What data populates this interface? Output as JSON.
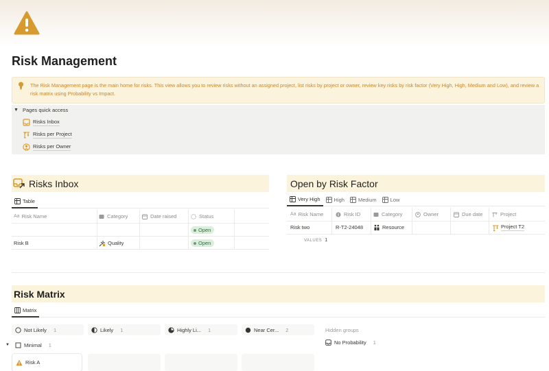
{
  "page": {
    "title": "Risk Management",
    "callout_text": "The Risk Management page is the main home for risks. This view allows you to review risks without an assigned project, list risks by project or owner, review key risks by risk factor (Very High, High, Medium and Low), and review a risk matrix using Probability vs Impact.",
    "icon": "warning-icon"
  },
  "quick_access": {
    "title": "Pages quick access",
    "items": [
      {
        "label": "Risks Inbox",
        "icon": "inbox-icon"
      },
      {
        "label": "Risks per Project",
        "icon": "crane-icon"
      },
      {
        "label": "Risks per Owner",
        "icon": "person-icon"
      }
    ]
  },
  "risks_inbox": {
    "title": "Risks Inbox",
    "tab": "Table",
    "columns": [
      "Risk Name",
      "Category",
      "Date raised",
      "Status"
    ],
    "rows": [
      {
        "name": "",
        "category": "",
        "date": "",
        "status": "Open"
      },
      {
        "name": "Risk B",
        "category": "Quality",
        "date": "",
        "status": "Open"
      }
    ]
  },
  "risk_factor": {
    "title": "Open by Risk Factor",
    "tabs": [
      "Very High",
      "High",
      "Medium",
      "Low"
    ],
    "columns": [
      "Risk Name",
      "Risk ID",
      "Category",
      "Owner",
      "Due date",
      "Project"
    ],
    "rows": [
      {
        "name": "Risk two",
        "risk_id": "R-T2-24048",
        "category": "Resource",
        "owner": "",
        "due": "",
        "project": "Project T2"
      }
    ],
    "values_label": "VALUES",
    "values_count": "1"
  },
  "risk_matrix": {
    "title": "Risk Matrix",
    "tab": "Matrix",
    "columns": [
      {
        "label": "Not Likely",
        "count": "1"
      },
      {
        "label": "Likely",
        "count": "1"
      },
      {
        "label": "Highly Li...",
        "count": "1"
      },
      {
        "label": "Near Cer...",
        "count": "2"
      }
    ],
    "hidden_groups_label": "Hidden groups",
    "hidden_group": {
      "label": "No Probability",
      "count": "1"
    },
    "row_group": {
      "label": "Minimal",
      "count": "1"
    },
    "card": {
      "label": "Risk A"
    }
  },
  "colors": {
    "callout_bg": "#fbf3db",
    "callout_text": "#c9852b",
    "header_bg": "#fbf3db",
    "icon_orange": "#d79a2f",
    "pill_bg": "#dbeddb",
    "pill_text": "#2f6f46"
  }
}
